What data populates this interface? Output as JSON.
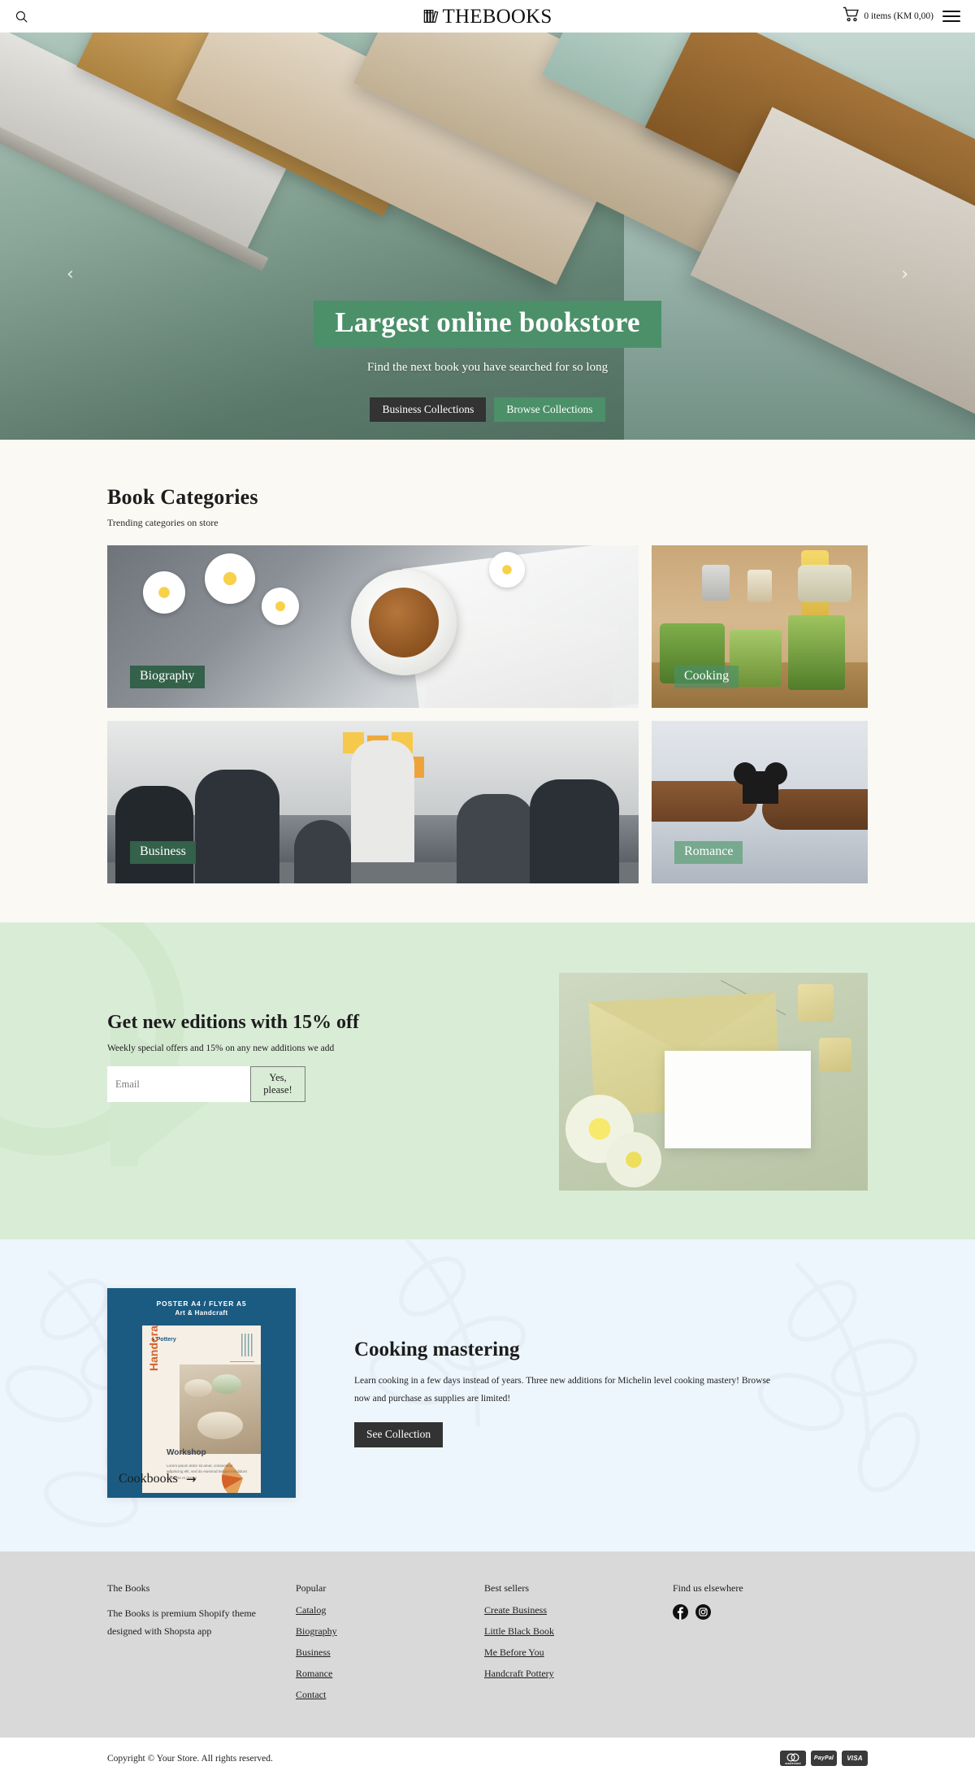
{
  "header": {
    "search_icon": "search-icon",
    "logo_text": "THEBOOKS",
    "logo_icon": "books-icon",
    "cart_icon": "cart-icon",
    "cart_label": "0 items (KM 0,00)",
    "menu_icon": "hamburger-menu-icon"
  },
  "hero": {
    "prev_arrow": "‹",
    "next_arrow": "›",
    "title": "Largest online bookstore",
    "subtitle": "Find the next book you have searched for so long",
    "primary_button": "Business Collections",
    "secondary_button": "Browse Collections",
    "title_bg": "#4b9069",
    "primary_bg": "#333333"
  },
  "categories": {
    "title": "Book Categories",
    "subtitle": "Trending categories on store",
    "items": [
      {
        "label": "Biography"
      },
      {
        "label": "Cooking"
      },
      {
        "label": "Business"
      },
      {
        "label": "Romance"
      }
    ]
  },
  "newsletter": {
    "title": "Get new editions with 15% off",
    "subtitle": "Weekly special offers and 15% on any new additions we add",
    "email_placeholder": "Email",
    "email_value": "",
    "submit_label": "Yes, please!",
    "bg": "#d9edd6"
  },
  "feature": {
    "poster": {
      "head_line1": "POSTER A4 / FLYER A5",
      "head_line2": "Art & Handcraft",
      "tag": "Pottery",
      "vertical_title": "Handcraft Pottery",
      "workshop_title": "Workshop",
      "workshop_body": "Lorem ipsum dolor sit amet, consectetur adipiscing elit, sed do eiusmod tempor incididunt ut labore et dolore",
      "overlay_label": "Cookbooks",
      "overlay_arrow": "→",
      "bg": "#1b5b82"
    },
    "title": "Cooking mastering",
    "body": "Learn cooking in a few days instead of years. Three new additions for Michelin level cooking mastery! Browse now and purchase as supplies are limited!",
    "button": "See Collection",
    "bg": "#eef6fd"
  },
  "footer": {
    "columns": [
      {
        "heading": "The Books",
        "description": "The Books is premium Shopify theme designed with Shopsta app",
        "links": []
      },
      {
        "heading": "Popular",
        "description": "",
        "links": [
          "Catalog",
          "Biography",
          "Business",
          "Romance",
          "Contact"
        ]
      },
      {
        "heading": "Best sellers",
        "description": "",
        "links": [
          "Create Business",
          "Little Black Book",
          "Me Before You",
          "Handcraft Pottery"
        ]
      },
      {
        "heading": "Find us elsewhere",
        "description": "",
        "links": []
      }
    ],
    "social": [
      {
        "name": "facebook-icon"
      },
      {
        "name": "instagram-icon"
      }
    ],
    "copyright": "Copyright © Your Store. All rights reserved.",
    "payments": [
      "mastercard",
      "PayPal",
      "VISA"
    ],
    "bg": "#d9d9d9"
  }
}
